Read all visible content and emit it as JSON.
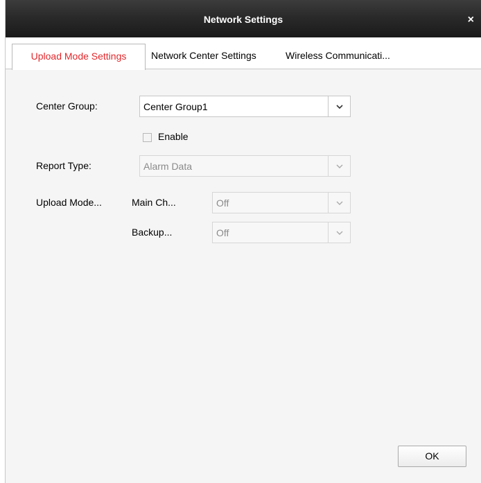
{
  "window": {
    "title": "Network Settings",
    "close_symbol": "×"
  },
  "tabs": [
    {
      "label": "Upload Mode Settings",
      "active": true
    },
    {
      "label": "Network Center Settings",
      "active": false
    },
    {
      "label": "Wireless Communicati...",
      "active": false
    }
  ],
  "form": {
    "center_group": {
      "label": "Center Group:",
      "value": "Center Group1",
      "enabled": true
    },
    "enable": {
      "label": "Enable",
      "checked": false
    },
    "report_type": {
      "label": "Report Type:",
      "value": "Alarm Data",
      "enabled": false
    },
    "upload_mode": {
      "label": "Upload Mode...",
      "main_channel": {
        "label": "Main Ch...",
        "value": "Off",
        "enabled": false
      },
      "backup": {
        "label": "Backup...",
        "value": "Off",
        "enabled": false
      }
    }
  },
  "buttons": {
    "ok": "OK"
  },
  "colors": {
    "active_tab_text": "#e4272b",
    "titlebar": "#2a2a2a",
    "panel": "#f5f5f5"
  },
  "icons": {
    "dropdown": "chevron-down-icon",
    "close": "close-icon"
  }
}
